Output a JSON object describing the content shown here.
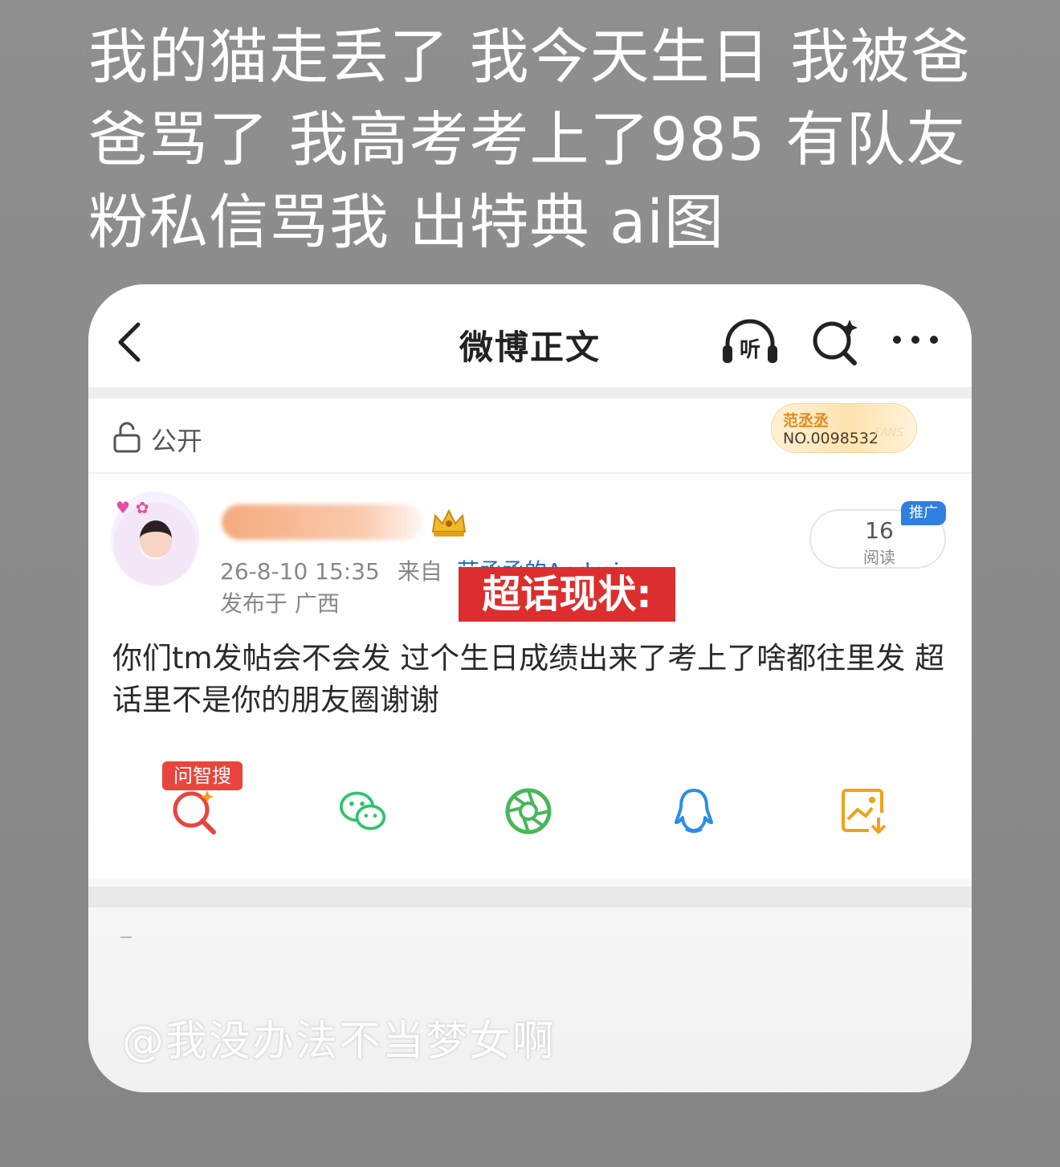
{
  "caption": {
    "line1": "我的猫走丢了 我今天生日 我被爸",
    "line2": "爸骂了 我高考考上了985 有队友",
    "line3": "粉私信骂我 出特典 ai图"
  },
  "header": {
    "title": "微博正文",
    "listen_label": "听"
  },
  "visibility": {
    "label": "公开"
  },
  "fan_badge": {
    "name": "范丞丞",
    "number": "NO.0098532",
    "tag": "FANS"
  },
  "post": {
    "timestamp": "26-8-10 15:35",
    "from_label": "来自",
    "source": "范丞丞的Android",
    "location": "发布于 广西",
    "overlay_label": "超话现状:",
    "read_count": "16",
    "read_label": "阅读",
    "promo_tag": "推广",
    "body": "你们tm发帖会不会发 过个生日成绩出来了考上了啥都往里发 超话里不是你的朋友圈谢谢"
  },
  "share": {
    "zhisou_tag": "问智搜",
    "colors": {
      "zhisou": "#e8453c",
      "wechat": "#2fc36b",
      "moments": "#47b75a",
      "qq": "#2a8ee8",
      "save": "#f0a21c"
    }
  },
  "watermark": "@我没办法不当梦女啊"
}
